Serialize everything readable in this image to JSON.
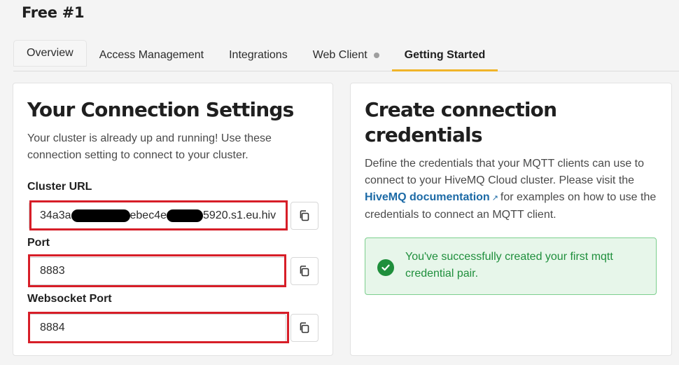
{
  "page": {
    "title": "Free #1"
  },
  "tabs": [
    {
      "label": "Overview"
    },
    {
      "label": "Access Management"
    },
    {
      "label": "Integrations"
    },
    {
      "label": "Web Client"
    },
    {
      "label": "Getting Started",
      "active": true
    }
  ],
  "connection": {
    "title": "Your Connection Settings",
    "description": "Your cluster is already up and running! Use these connection setting to connect to your cluster.",
    "cluster_url": {
      "label": "Cluster URL",
      "value_part1": "34a3a",
      "value_part2": "ebec4e",
      "value_part3": "5920.s1.eu.hiv"
    },
    "port": {
      "label": "Port",
      "value": "8883"
    },
    "websocket_port": {
      "label": "Websocket Port",
      "value": "8884"
    }
  },
  "credentials": {
    "title": "Create connection credentials",
    "description_before": "Define the credentials that your MQTT clients can use to connect to your HiveMQ Cloud cluster. Please visit the",
    "link_text": "HiveMQ documentation",
    "description_after": "for examples on how to use the credentials to connect an MQTT client.",
    "success_message": "You've successfully created your first mqtt credential pair."
  },
  "colors": {
    "accent": "#f0b429",
    "highlight": "#d71e28",
    "success": "#1f8f3c",
    "link": "#1c6aa6"
  }
}
